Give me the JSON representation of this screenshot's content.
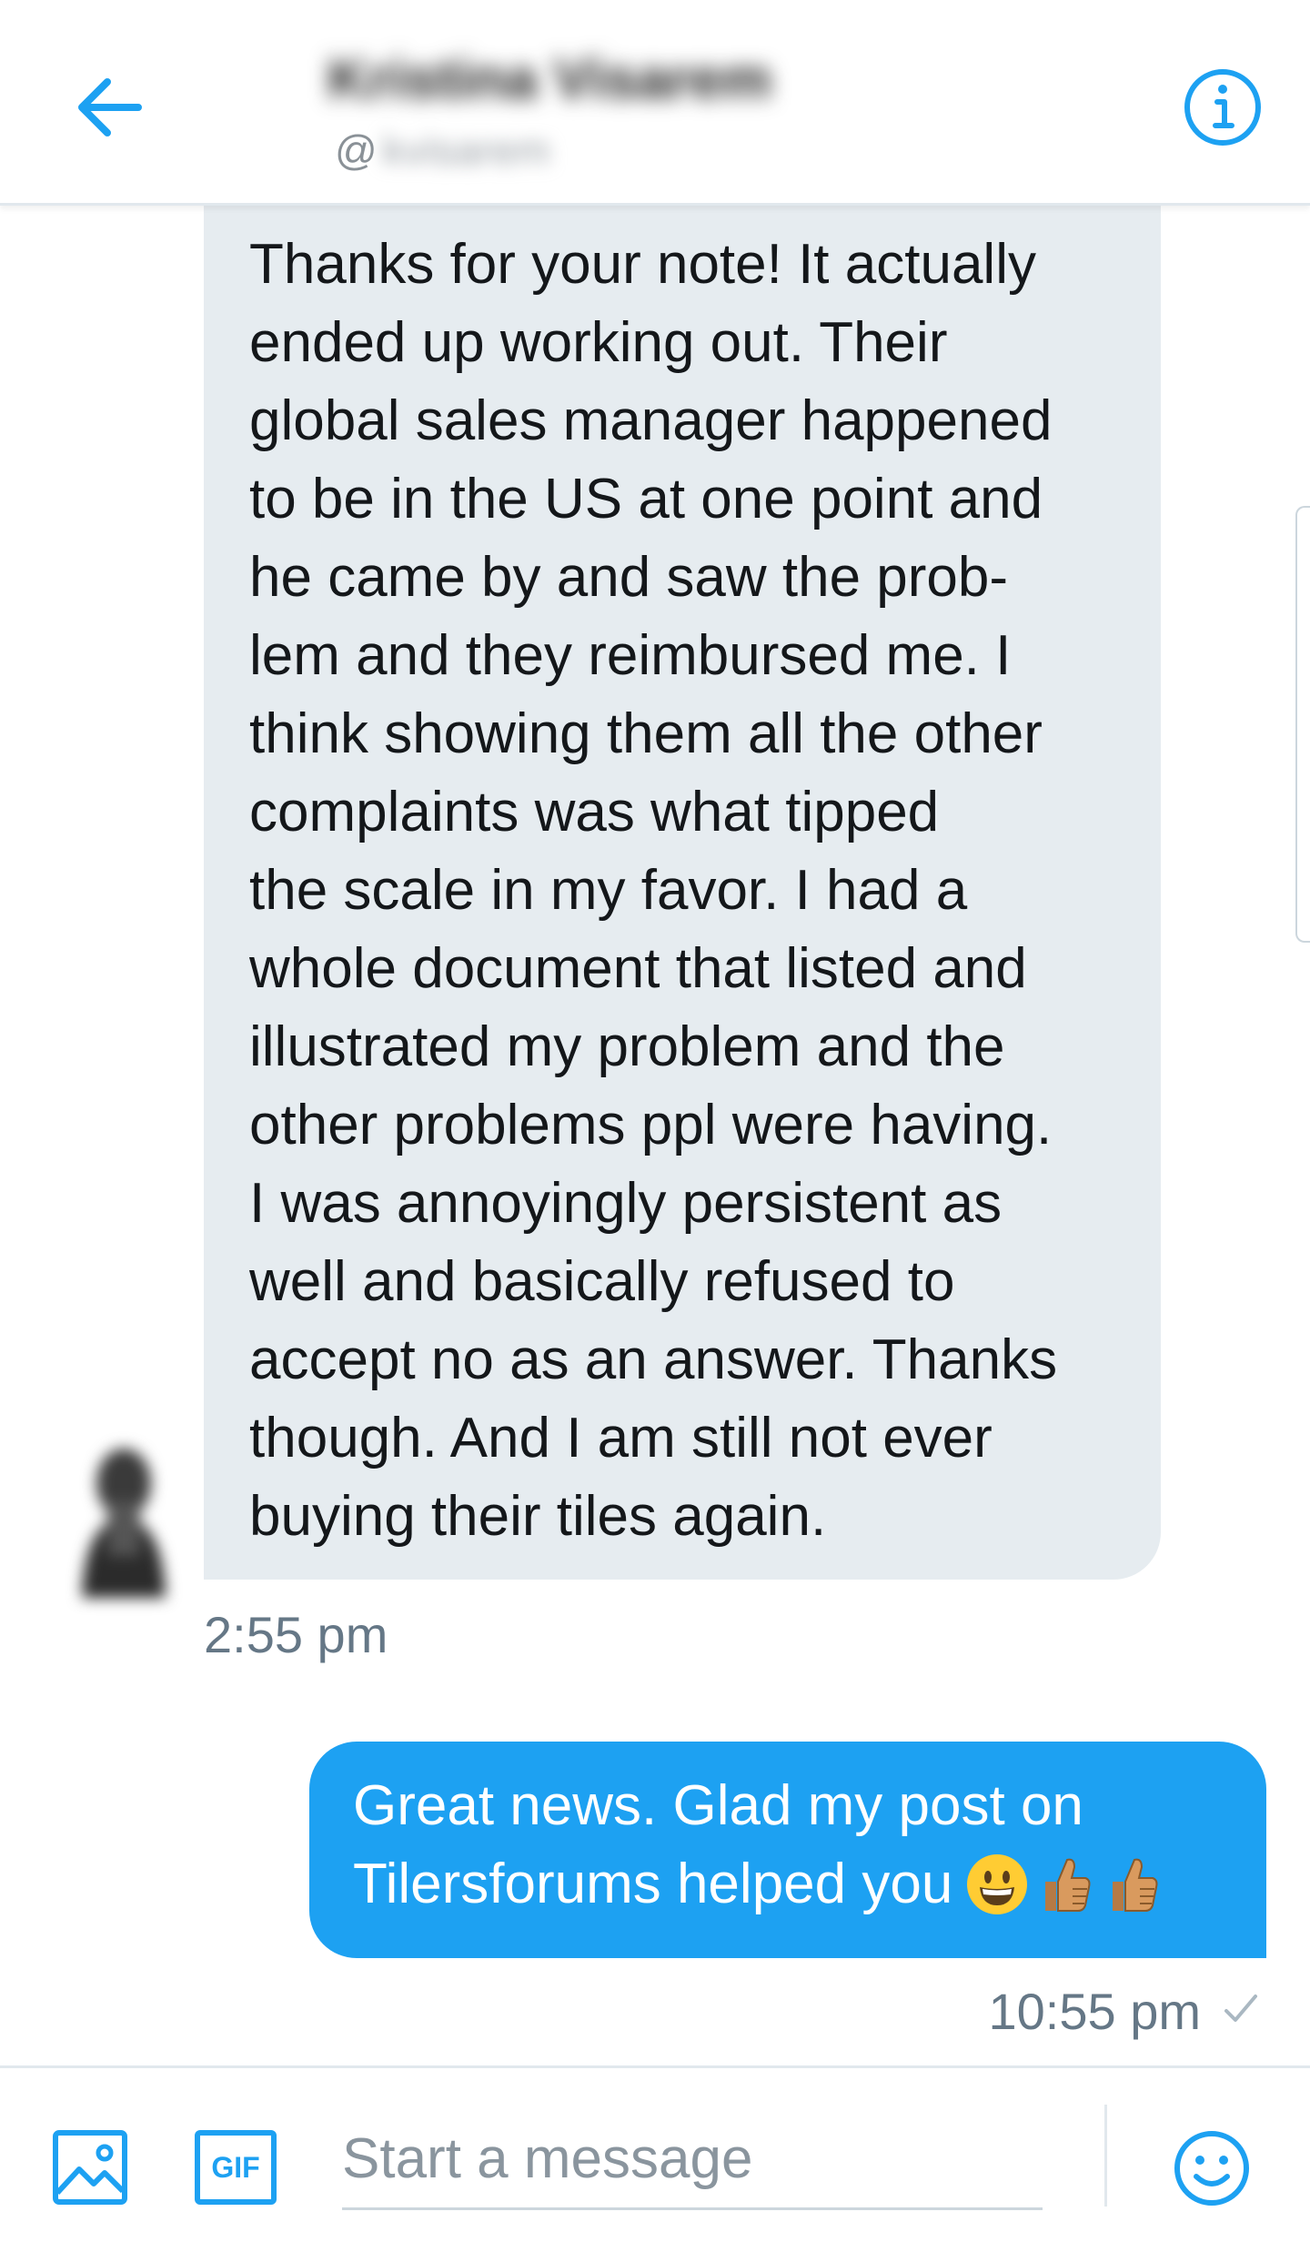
{
  "header": {
    "contact_name": "Kristina Visarem",
    "contact_handle_prefix": "@",
    "contact_handle_hidden": "kvisarem"
  },
  "messages": {
    "received": {
      "text": "Thanks for your note! It actually\nended up working out. Their\nglobal sales manager happened\nto be in the US at one point and\nhe came by and saw the prob-\nlem and they reimbursed me. I\nthink showing them all the other\ncomplaints was what tipped\nthe scale in my favor. I had a\nwhole document that listed and\nillustrated my problem and the\nother problems ppl were having.\nI was annoyingly persistent as\nwell and basically refused to\naccept no as an answer. Thanks\nthough. And I am still not ever\nbuying their tiles again.",
      "time": "2:55 pm"
    },
    "sent": {
      "line1": "Great news. Glad my post on",
      "line2": "Tilersforums helped you",
      "emoji_smile": "😀",
      "emoji_thumb1": "👍",
      "emoji_thumb2": "👍",
      "time": "10:55 pm",
      "status_icon": "check-icon"
    }
  },
  "composer": {
    "placeholder": "Start a message",
    "gif_label": "GIF"
  },
  "colors": {
    "accent": "#1da1f2",
    "received_bubble": "#e6ecf0",
    "text_primary": "#14171a",
    "text_secondary": "#657786"
  }
}
